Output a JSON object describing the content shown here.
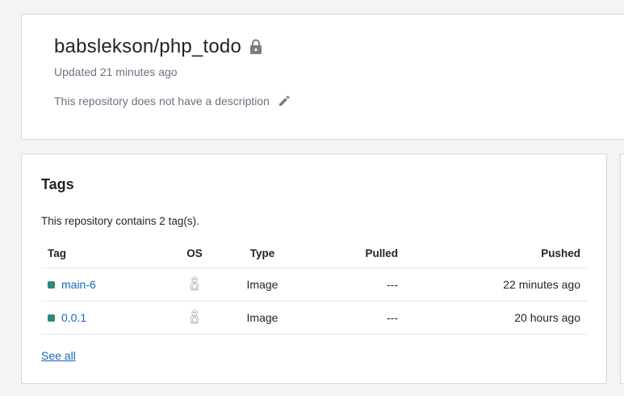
{
  "repo": {
    "title": "babslekson/php_todo",
    "updated": "Updated 21 minutes ago",
    "description": "This repository does not have a description"
  },
  "tags": {
    "heading": "Tags",
    "count_text": "This repository contains 2 tag(s).",
    "columns": {
      "tag": "Tag",
      "os": "OS",
      "type": "Type",
      "pulled": "Pulled",
      "pushed": "Pushed"
    },
    "rows": [
      {
        "tag": "main-6",
        "os_icon": "linux-tux-icon",
        "type": "Image",
        "pulled": "---",
        "pushed": "22 minutes ago"
      },
      {
        "tag": "0.0.1",
        "os_icon": "linux-tux-icon",
        "type": "Image",
        "pulled": "---",
        "pushed": "20 hours ago"
      }
    ],
    "see_all": "See all"
  },
  "colors": {
    "tag_status": "#2d8a78",
    "link": "#1565c0",
    "muted": "#6b7280"
  }
}
